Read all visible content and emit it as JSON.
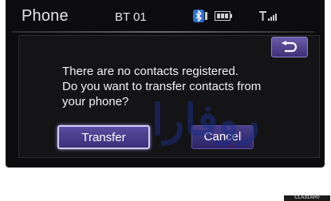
{
  "header": {
    "title": "Phone",
    "device_name": "BT 01",
    "icons": [
      "bluetooth-icon",
      "phone-icon",
      "battery-icon",
      "signal-icon"
    ]
  },
  "dialog": {
    "message_lines": [
      "There are no contacts registered.",
      "Do you want to transfer contacts from",
      "your phone?"
    ],
    "transfer_label": "Transfer",
    "cancel_label": "Cancel",
    "back_icon": "return-arrow-icon"
  },
  "image_code": "CLA31AR0",
  "colors": {
    "screen_bg": "#0c0c0e",
    "button_purple": "#4a3e8a",
    "focus_outline": "#d4cdf5"
  }
}
